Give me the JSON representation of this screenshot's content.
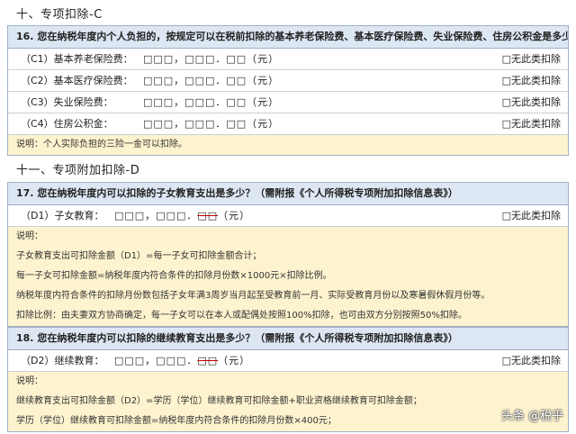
{
  "sections": [
    {
      "title": "十、专项扣除-C"
    },
    {
      "title": "十一、专项附加扣除-D"
    }
  ],
  "q16": {
    "question": "16. 您在纳税年度内个人负担的，按规定可以在税前扣除的基本养老保险费、基本医疗保险费、失业保险费、住房公积金是多少？",
    "rows": [
      {
        "label": "（C1）基本养老保险费：",
        "amount": "□□□，□□□．□□（元）",
        "option": "□无此类扣除"
      },
      {
        "label": "（C2）基本医疗保险费：",
        "amount": "□□□，□□□．□□（元）",
        "option": "□无此类扣除"
      },
      {
        "label": "（C3）失业保险费：",
        "amount": "□□□，□□□．□□（元）",
        "option": "□无此类扣除"
      },
      {
        "label": "（C4）住房公积金：",
        "amount": "□□□，□□□．□□（元）",
        "option": "□无此类扣除"
      }
    ],
    "note": "说明：个人实际负担的三险一金可以扣除。"
  },
  "q17": {
    "question": "17. 您在纳税年度内可以扣除的子女教育支出是多少？（需附报《个人所得税专项附加扣除信息表》）",
    "row": {
      "label": "（D1）子女教育：",
      "amount_main": "□□□，□□□．",
      "amount_strike": "□□",
      "amount_unit": "（元）",
      "option": "□无此类扣除"
    },
    "notes": [
      "说明：",
      "子女教育支出可扣除金额（D1）=每一子女可扣除金额合计；",
      "每一子女可扣除金额=纳税年度内符合条件的扣除月份数×1000元×扣除比例。",
      "纳税年度内符合条件的扣除月份数包括子女年满3周岁当月起至受教育前一月、实际受教育月份以及寒暑假休假月份等。",
      "扣除比例：由夫妻双方协商确定，每一子女可以在本人或配偶处按照100%扣除，也可由双方分别按照50%扣除。"
    ]
  },
  "q18": {
    "question": "18. 您在纳税年度内可以扣除的继续教育支出是多少？（需附报《个人所得税专项附加扣除信息表》）",
    "row": {
      "label": "（D2）继续教育：",
      "amount_main": "□□□，□□□．",
      "amount_strike": "□□",
      "amount_unit": "（元）",
      "option": "□无此类扣除"
    },
    "notes": [
      "说明：",
      "继续教育支出可扣除金额（D2）=学历（学位）继续教育可扣除金额+职业资格继续教育可扣除金额；",
      "学历（学位）继续教育可扣除金额=纳税年度内符合条件的扣除月份数×400元；"
    ]
  },
  "watermark": "头条 @税乎"
}
